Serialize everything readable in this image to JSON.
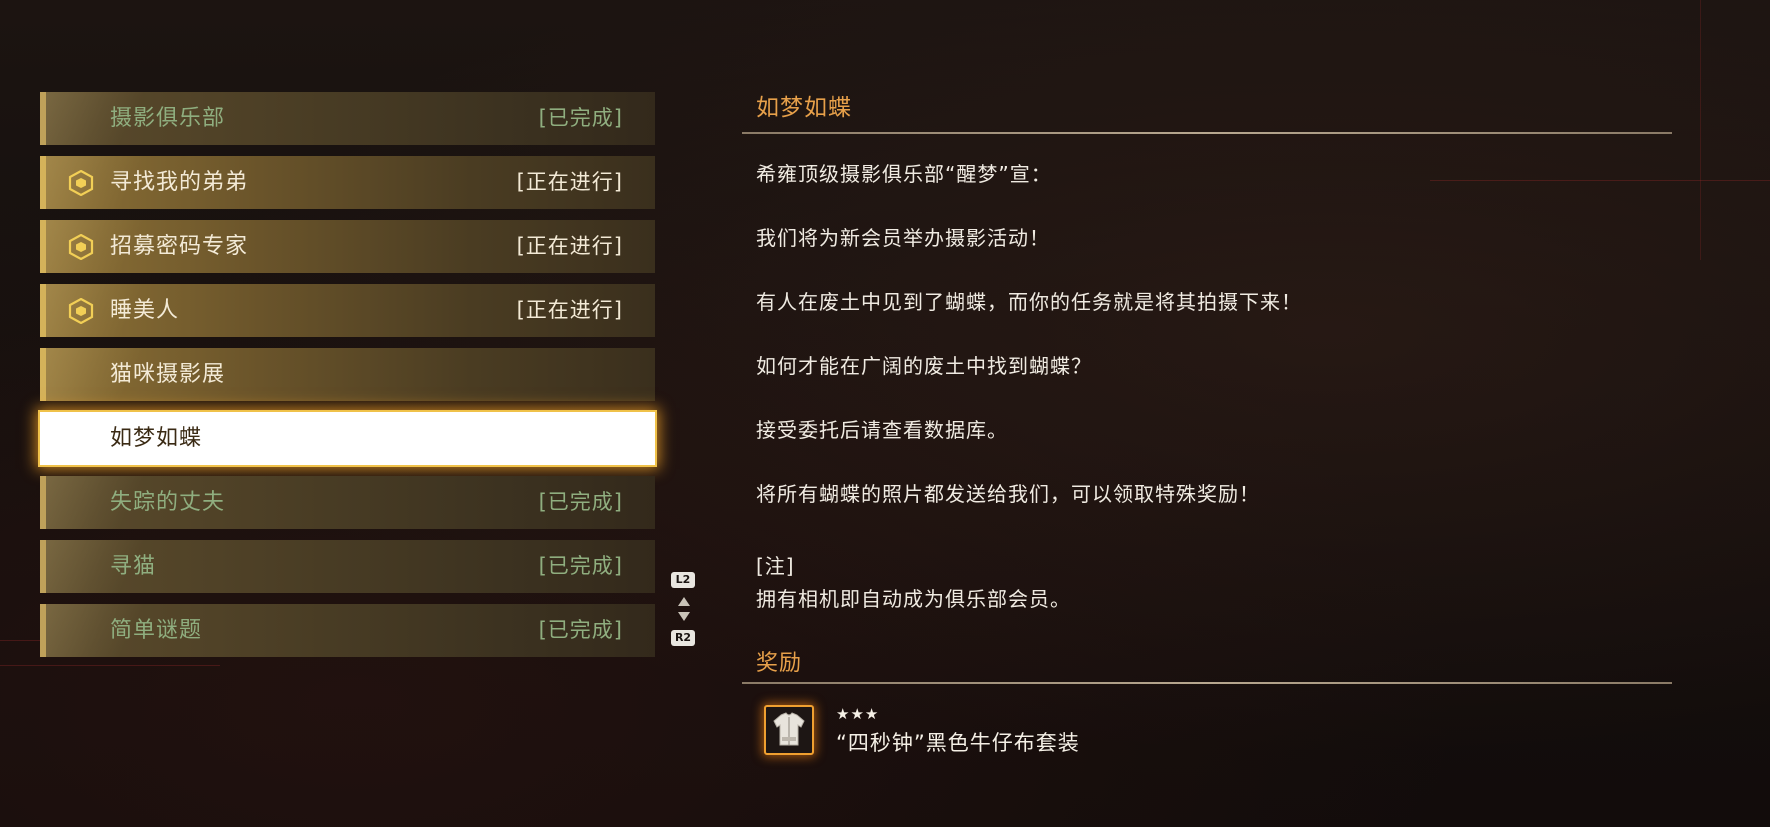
{
  "quests": [
    {
      "name": "摄影俱乐部",
      "status": "[已完成]"
    },
    {
      "name": "寻找我的弟弟",
      "status": "[正在进行]"
    },
    {
      "name": "招募密码专家",
      "status": "[正在进行]"
    },
    {
      "name": "睡美人",
      "status": "[正在进行]"
    },
    {
      "name": "猫咪摄影展",
      "status": ""
    },
    {
      "name": "如梦如蝶",
      "status": ""
    },
    {
      "name": "失踪的丈夫",
      "status": "[已完成]"
    },
    {
      "name": "寻猫",
      "status": "[已完成]"
    },
    {
      "name": "简单谜题",
      "status": "[已完成]"
    }
  ],
  "scroll_hint": {
    "up_button": "L2",
    "down_button": "R2"
  },
  "detail": {
    "title": "如梦如蝶",
    "lines": [
      "希雍顶级摄影俱乐部“醒梦”宣：",
      "我们将为新会员举办摄影活动！",
      "有人在废土中见到了蝴蝶，而你的任务就是将其拍摄下来！",
      "如何才能在广阔的废土中找到蝴蝶？",
      "接受委托后请查看数据库。",
      "将所有蝴蝶的照片都发送给我们，可以领取特殊奖励！",
      "[注]",
      "拥有相机即自动成为俱乐部会员。"
    ]
  },
  "reward": {
    "title": "奖励",
    "stars": "★★★",
    "item_name": "“四秒钟”黑色牛仔布套装",
    "icon": "outfit-icon"
  },
  "colors": {
    "accent_orange": "#e7a04a",
    "completed_green": "#8fae7f",
    "gold_border": "#d4b25a"
  }
}
